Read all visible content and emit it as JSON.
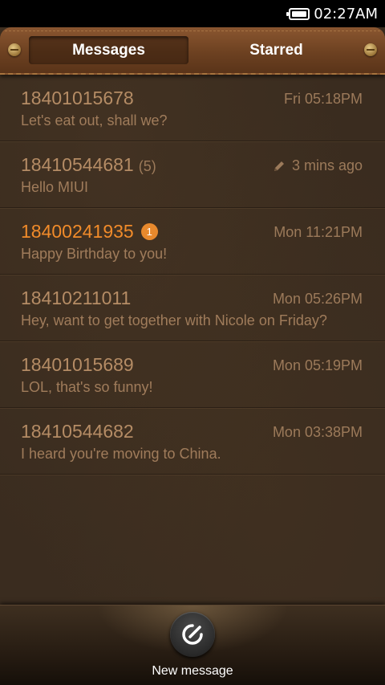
{
  "status_bar": {
    "time": "02:27AM"
  },
  "tabs": {
    "messages": "Messages",
    "starred": "Starred"
  },
  "conversations": [
    {
      "number": "18401015678",
      "count": "",
      "time": "Fri 05:18PM",
      "preview": "Let's eat out, shall we?",
      "unread_badge": ""
    },
    {
      "number": "18410544681",
      "count": "(5)",
      "time": "3 mins ago",
      "preview": "Hello MIUI",
      "unread_badge": "",
      "draft_icon": "pencil-icon"
    },
    {
      "number": "18400241935",
      "count": "",
      "time": "Mon 11:21PM",
      "preview": "Happy Birthday to you!",
      "unread_badge": "1"
    },
    {
      "number": "18410211011",
      "count": "",
      "time": "Mon 05:26PM",
      "preview": "Hey, want to get together with Nicole on Friday?",
      "unread_badge": ""
    },
    {
      "number": "18401015689",
      "count": "",
      "time": "Mon 05:19PM",
      "preview": "LOL, that's so funny!",
      "unread_badge": ""
    },
    {
      "number": "18410544682",
      "count": "",
      "time": "Mon 03:38PM",
      "preview": "I heard you're moving to China.",
      "unread_badge": ""
    }
  ],
  "bottom": {
    "compose_label": "New message",
    "compose_icon": "compose-icon"
  },
  "colors": {
    "unread": "#f18b2a",
    "number": "#b58c65",
    "text": "#a07c5b",
    "background": "#3a2c1f"
  }
}
